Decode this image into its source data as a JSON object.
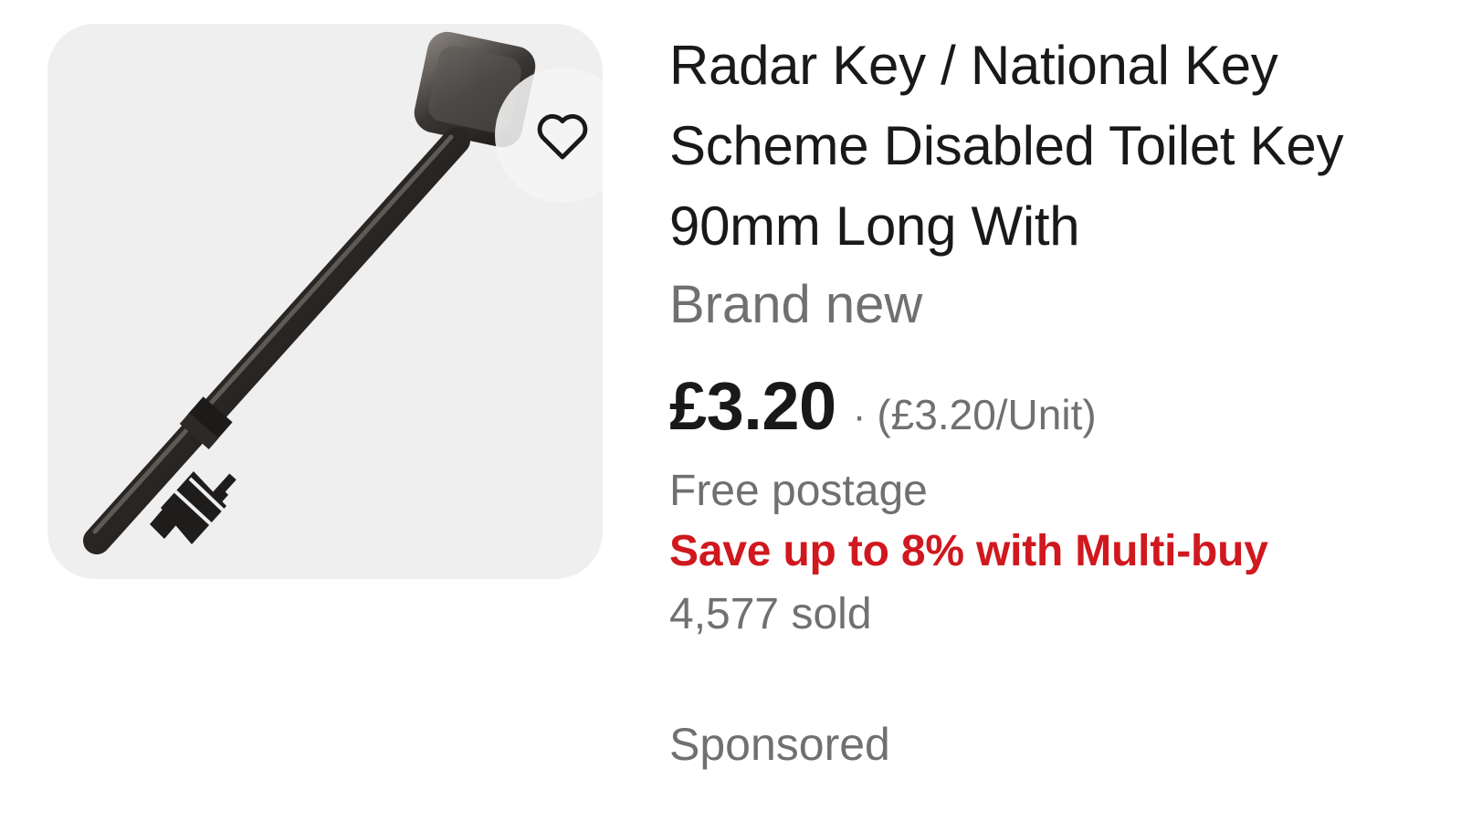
{
  "listing": {
    "title": "Radar Key / National Key Scheme Disabled Toilet Key 90mm Long With",
    "condition": "Brand new",
    "price": "£3.20",
    "separator": "·",
    "unit_price": "(£3.20/Unit)",
    "shipping": "Free postage",
    "promo": "Save up to 8% with Multi-buy",
    "sold": "4,577 sold",
    "sponsored": "Sponsored"
  },
  "image": {
    "subject": "radar-key-photo",
    "background_color": "#efefef"
  },
  "icons": {
    "watch": "heart-icon"
  },
  "colors": {
    "title": "#191919",
    "secondary": "#707070",
    "promo": "#d0181e"
  }
}
